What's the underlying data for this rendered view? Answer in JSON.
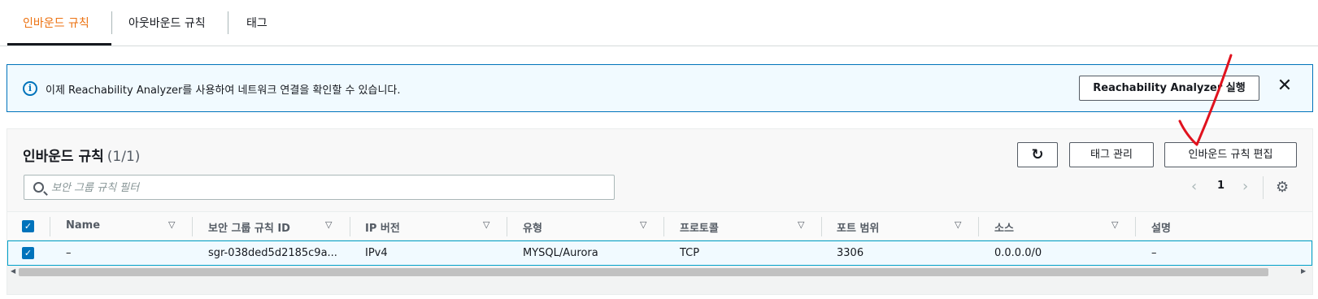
{
  "tabs": {
    "inbound": "인바운드 규칙",
    "outbound": "아웃바운드 규칙",
    "tags": "태그"
  },
  "banner": {
    "info_icon": "info-icon",
    "text": "이제 Reachability Analyzer를 사용하여 네트워크 연결을 확인할 수 있습니다.",
    "button": "Reachability Analyzer 실행",
    "close": "✕"
  },
  "panel": {
    "title": "인바운드 규칙",
    "count": "(1/1)",
    "refresh_icon": "↻",
    "tag_button": "태그 관리",
    "edit_button": "인바운드 규칙 편집",
    "search_placeholder": "보안 그룹 규칙 필터",
    "pager_prev": "‹",
    "page": "1",
    "pager_next": "›",
    "settings_icon": "⚙"
  },
  "table": {
    "headers": [
      "Name",
      "보안 그룹 규칙 ID",
      "IP 버전",
      "유형",
      "프로토콜",
      "포트 범위",
      "소스",
      "설명"
    ],
    "rows": [
      {
        "name": "–",
        "rule_id": "sgr-038ded5d2185c9a...",
        "ip_version": "IPv4",
        "type": "MYSQL/Aurora",
        "protocol": "TCP",
        "port_range": "3306",
        "source": "0.0.0.0/0",
        "description": "–"
      }
    ]
  },
  "colors": {
    "active_tab": "#ec7211",
    "info_blue": "#0073bb",
    "annotation_red": "#e0121e"
  }
}
